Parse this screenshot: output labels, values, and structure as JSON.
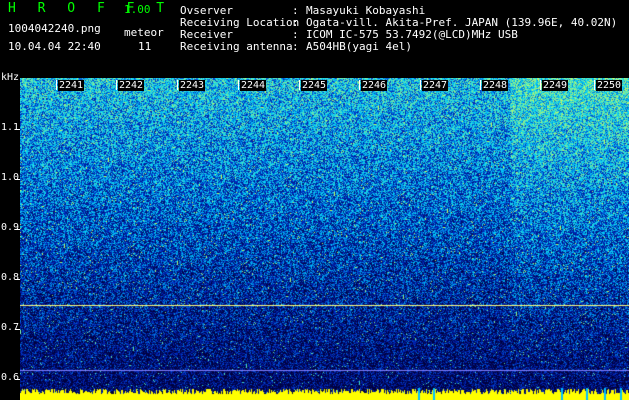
{
  "header": {
    "app_title": "H R O F F T",
    "version": "1.00",
    "filename": "1004042240.png",
    "meteor_label": "meteor",
    "datetime": "10.04.04 22:40",
    "meteor_count": "11"
  },
  "info": [
    {
      "key": "Ovserver",
      "value": "Masayuki Kobayashi"
    },
    {
      "key": "Receiving Location",
      "value": "Ogata-vill. Akita-Pref. JAPAN (139.96E, 40.02N)"
    },
    {
      "key": "Receiver",
      "value": "ICOM IC-575 53.7492(@LCD)MHz USB"
    },
    {
      "key": "Receiving antenna",
      "value": "A504HB(yagi 4el)"
    }
  ],
  "y_axis": {
    "unit": "kHz",
    "ticks": [
      "1.1",
      "1.0",
      "0.9",
      "0.8",
      "0.7",
      "0.6"
    ]
  },
  "time_axis": {
    "ticks": [
      "2241",
      "2242",
      "2243",
      "2244",
      "2245",
      "2246",
      "2247",
      "2248",
      "2249",
      "2250"
    ]
  },
  "colors": {
    "title": "#00ff00",
    "spectrum_bg": "#000060",
    "signal_line": "#ffff80",
    "bottom_band": "#ffff00"
  }
}
